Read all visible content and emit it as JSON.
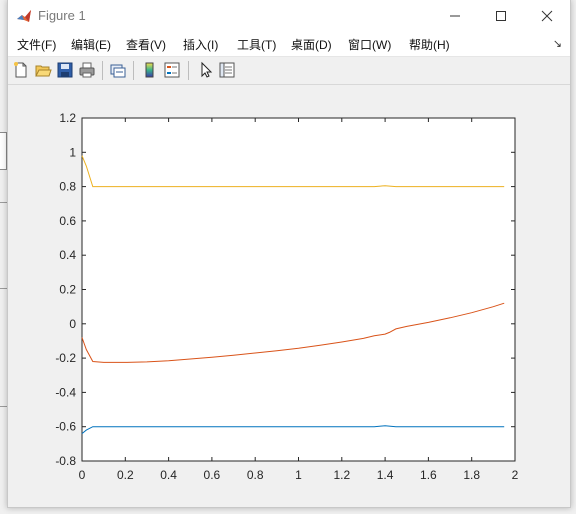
{
  "window": {
    "title": "Figure 1"
  },
  "menu": [
    {
      "label": "文件(F)"
    },
    {
      "label": "编辑(E)"
    },
    {
      "label": "查看(V)"
    },
    {
      "label": "插入(I)"
    },
    {
      "label": "工具(T)"
    },
    {
      "label": "桌面(D)"
    },
    {
      "label": "窗口(W)"
    },
    {
      "label": "帮助(H)"
    }
  ],
  "toolbar": {
    "icons": [
      "new-figure-icon",
      "open-file-icon",
      "save-icon",
      "print-icon",
      "link-plot-icon",
      "colorbar-icon",
      "legend-icon",
      "edit-plot-arrow-icon",
      "property-inspector-icon"
    ]
  },
  "colors": {
    "series1": "#0072BD",
    "series2": "#D95319",
    "series3": "#EDB120",
    "axes": "#262626"
  },
  "chart_data": {
    "type": "line",
    "title": "",
    "xlabel": "",
    "ylabel": "",
    "xlim": [
      0,
      2
    ],
    "ylim": [
      -0.8,
      1.2
    ],
    "x_ticks": [
      "0",
      "0.2",
      "0.4",
      "0.6",
      "0.8",
      "1",
      "1.2",
      "1.4",
      "1.6",
      "1.8",
      "2"
    ],
    "y_ticks": [
      "-0.8",
      "-0.6",
      "-0.4",
      "-0.2",
      "0",
      "0.2",
      "0.4",
      "0.6",
      "0.8",
      "1",
      "1.2"
    ],
    "series": [
      {
        "color": "#0072BD",
        "points": [
          [
            0,
            -0.64
          ],
          [
            0.02,
            -0.62
          ],
          [
            0.05,
            -0.6
          ],
          [
            0.3,
            -0.6
          ],
          [
            0.6,
            -0.6
          ],
          [
            0.9,
            -0.6
          ],
          [
            1.2,
            -0.6
          ],
          [
            1.35,
            -0.6
          ],
          [
            1.4,
            -0.595
          ],
          [
            1.45,
            -0.6
          ],
          [
            1.6,
            -0.6
          ],
          [
            1.8,
            -0.6
          ],
          [
            1.95,
            -0.6
          ]
        ]
      },
      {
        "color": "#D95319",
        "points": [
          [
            0,
            -0.08
          ],
          [
            0.02,
            -0.15
          ],
          [
            0.05,
            -0.22
          ],
          [
            0.1,
            -0.225
          ],
          [
            0.2,
            -0.225
          ],
          [
            0.3,
            -0.222
          ],
          [
            0.4,
            -0.215
          ],
          [
            0.5,
            -0.205
          ],
          [
            0.6,
            -0.195
          ],
          [
            0.7,
            -0.183
          ],
          [
            0.8,
            -0.17
          ],
          [
            0.9,
            -0.157
          ],
          [
            1.0,
            -0.142
          ],
          [
            1.1,
            -0.125
          ],
          [
            1.2,
            -0.106
          ],
          [
            1.3,
            -0.085
          ],
          [
            1.35,
            -0.07
          ],
          [
            1.4,
            -0.06
          ],
          [
            1.42,
            -0.05
          ],
          [
            1.45,
            -0.03
          ],
          [
            1.5,
            -0.015
          ],
          [
            1.6,
            0.008
          ],
          [
            1.7,
            0.035
          ],
          [
            1.8,
            0.065
          ],
          [
            1.9,
            0.1
          ],
          [
            1.95,
            0.12
          ]
        ]
      },
      {
        "color": "#EDB120",
        "points": [
          [
            0,
            0.98
          ],
          [
            0.02,
            0.92
          ],
          [
            0.05,
            0.8
          ],
          [
            0.3,
            0.8
          ],
          [
            0.6,
            0.8
          ],
          [
            0.9,
            0.8
          ],
          [
            1.2,
            0.8
          ],
          [
            1.35,
            0.8
          ],
          [
            1.4,
            0.805
          ],
          [
            1.45,
            0.8
          ],
          [
            1.6,
            0.8
          ],
          [
            1.8,
            0.8
          ],
          [
            1.95,
            0.8
          ]
        ]
      }
    ]
  }
}
